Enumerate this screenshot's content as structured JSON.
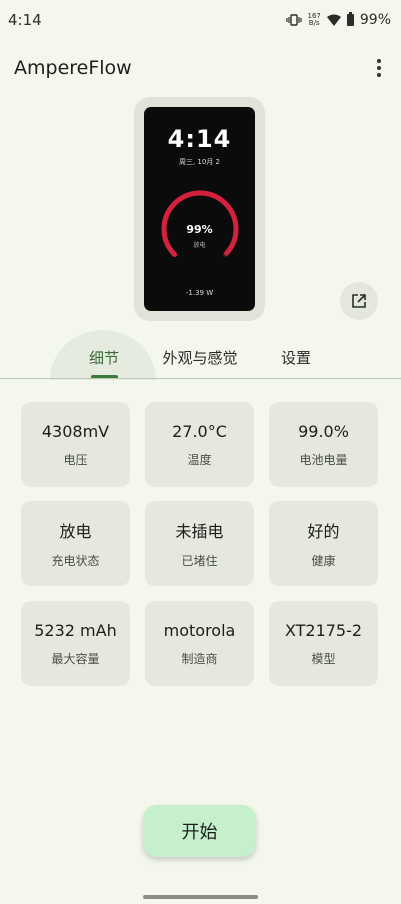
{
  "status_bar": {
    "time": "4:14",
    "net_speed_value": "167",
    "net_speed_unit": "B/s",
    "battery": "99%"
  },
  "app": {
    "title": "AmpereFlow"
  },
  "preview": {
    "time": "4:14",
    "date": "周三, 10月 2",
    "percent": "99%",
    "state": "放电",
    "power": "-1.39 W",
    "gauge_level": 0.99,
    "accent": "#d4213d"
  },
  "tabs": [
    {
      "label": "细节",
      "active": true
    },
    {
      "label": "外观与感觉",
      "active": false
    },
    {
      "label": "设置",
      "active": false
    }
  ],
  "cards": [
    {
      "value": "4308mV",
      "label": "电压"
    },
    {
      "value": "27.0°C",
      "label": "温度"
    },
    {
      "value": "99.0%",
      "label": "电池电量"
    },
    {
      "value": "放电",
      "label": "充电状态"
    },
    {
      "value": "未插电",
      "label": "已堵住"
    },
    {
      "value": "好的",
      "label": "健康"
    },
    {
      "value": "5232 mAh",
      "label": "最大容量"
    },
    {
      "value": "motorola",
      "label": "制造商"
    },
    {
      "value": "XT2175-2",
      "label": "模型"
    }
  ],
  "start_button": {
    "label": "开始"
  },
  "colors": {
    "background": "#f4f7ee",
    "card": "#e5e8df",
    "primary": "#3b7a3b",
    "start_button": "#c6efcc"
  }
}
